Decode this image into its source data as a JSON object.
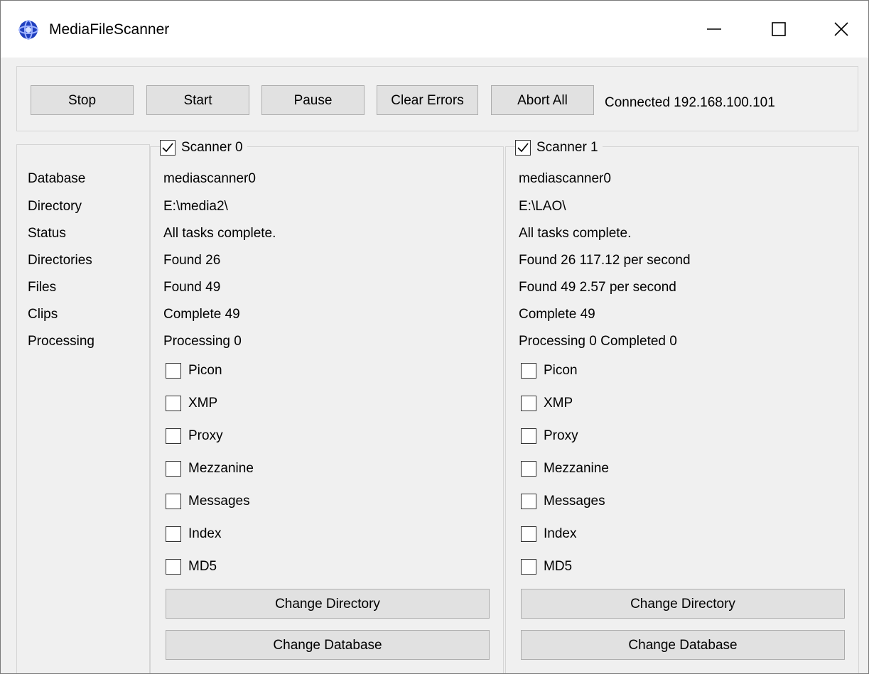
{
  "window": {
    "title": "MediaFileScanner",
    "icon": "app-globe-icon"
  },
  "toolbar": {
    "stop_label": "Stop",
    "start_label": "Start",
    "pause_label": "Pause",
    "clear_errors_label": "Clear Errors",
    "abort_all_label": "Abort All",
    "connection_status": "Connected 192.168.100.101"
  },
  "sidebar": {
    "rows": [
      "Database",
      "Directory",
      "Status",
      "Directories",
      "Files",
      "Clips",
      "Processing"
    ]
  },
  "scanners": [
    {
      "name": "Scanner 0",
      "enabled": true,
      "database": "mediascanner0",
      "directory": "E:\\media2\\",
      "status": "All tasks complete.",
      "directories": "Found 26",
      "files": "Found 49",
      "clips": "Complete 49",
      "processing": "Processing 0",
      "options": [
        {
          "label": "Picon",
          "checked": false
        },
        {
          "label": "XMP",
          "checked": false
        },
        {
          "label": "Proxy",
          "checked": false
        },
        {
          "label": "Mezzanine",
          "checked": false
        },
        {
          "label": "Messages",
          "checked": false
        },
        {
          "label": "Index",
          "checked": false
        },
        {
          "label": "MD5",
          "checked": false
        }
      ],
      "change_directory_label": "Change Directory",
      "change_database_label": "Change Database"
    },
    {
      "name": "Scanner 1",
      "enabled": true,
      "database": "mediascanner0",
      "directory": "E:\\LAO\\",
      "status": "All tasks complete.",
      "directories": "Found 26 117.12 per second",
      "files": "Found 49 2.57 per second",
      "clips": "Complete 49",
      "processing": "Processing 0 Completed 0",
      "options": [
        {
          "label": "Picon",
          "checked": false
        },
        {
          "label": "XMP",
          "checked": false
        },
        {
          "label": "Proxy",
          "checked": false
        },
        {
          "label": "Mezzanine",
          "checked": false
        },
        {
          "label": "Messages",
          "checked": false
        },
        {
          "label": "Index",
          "checked": false
        },
        {
          "label": "MD5",
          "checked": false
        }
      ],
      "change_directory_label": "Change Directory",
      "change_database_label": "Change Database"
    }
  ],
  "colors": {
    "window_bg": "#f0f0f0",
    "button_bg": "#e1e1e1",
    "button_border": "#adadad",
    "group_border": "#d5d5d5",
    "icon_blue": "#1f3fbf"
  }
}
